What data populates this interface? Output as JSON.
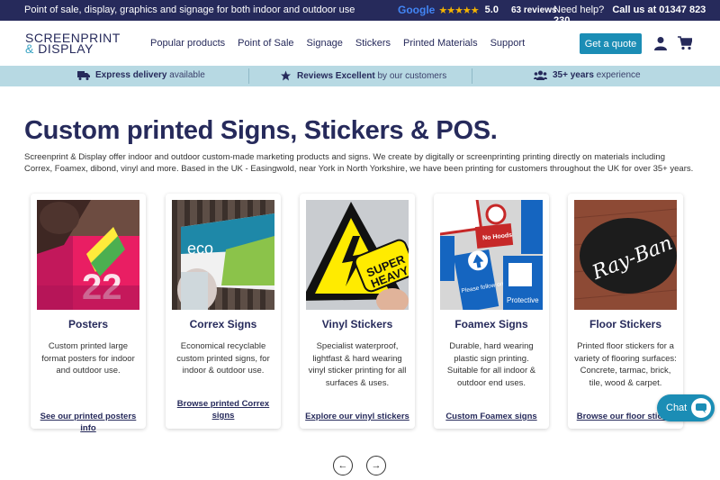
{
  "topbar": {
    "tagline": "Point of sale, display, graphics and signage for both indoor and outdoor use",
    "rating_brand": "Google",
    "rating_stars": "★★★★★",
    "rating_score": "5.0",
    "rating_reviews": "63 reviews",
    "help_text": "Need help?",
    "phone": "Call us at 01347 823 230"
  },
  "logo": {
    "line1": "SCREENPRINT",
    "line2_amp": "&",
    "line2": "DISPLAY"
  },
  "nav": {
    "links": [
      "Popular products",
      "Point of Sale",
      "Signage",
      "Stickers",
      "Printed Materials",
      "Support"
    ],
    "quote_button": "Get a quote"
  },
  "usp": [
    {
      "bold": "Express delivery",
      "rest": "available",
      "icon": "truck-icon"
    },
    {
      "bold": "Reviews Excellent",
      "rest": "by our customers",
      "icon": "star-icon"
    },
    {
      "bold": "35+ years",
      "rest": "experience",
      "icon": "people-icon"
    }
  ],
  "hero": {
    "title": "Custom printed Signs, Stickers & POS.",
    "text": "Screenprint & Display offer indoor and outdoor custom-made marketing products and signs. We create by digitally or screenprinting printing directly on materials including Correx, Foamex, dibond, vinyl and more. Based in the UK - Easingwold, near York in North Yorkshire, we have been printing for customers throughout the UK for over 35+ years."
  },
  "cards": [
    {
      "title": "Posters",
      "desc": "Custom printed large format posters for indoor and outdoor use.",
      "link": "See our printed posters info"
    },
    {
      "title": "Correx Signs",
      "desc": "Economical recyclable custom printed signs, for indoor & outdoor use.",
      "link": "Browse printed Correx signs"
    },
    {
      "title": "Vinyl Stickers",
      "desc": "Specialist waterproof, lightfast & hard wearing vinyl sticker printing for all surfaces & uses.",
      "link": "Explore our vinyl stickers"
    },
    {
      "title": "Foamex Signs",
      "desc": "Durable, hard wearing plastic sign printing. Suitable for all indoor & outdoor end uses.",
      "link": "Custom Foamex signs"
    },
    {
      "title": "Floor Stickers",
      "desc": "Printed floor stickers for a variety of flooring surfaces: Concrete, tarmac, brick, tile, wood & carpet.",
      "link": "Browse our floor stickers"
    }
  ],
  "card_images": {
    "correx_text": "eco",
    "vinyl_text1": "SUPER",
    "vinyl_text2": "HEAVY",
    "foamex_text1": "No Hoods",
    "foamex_text2": "Please follow one way system",
    "foamex_text3": "Protective",
    "floor_text": "Ray-Ban",
    "posters_text": "22"
  },
  "chat": {
    "label": "Chat"
  },
  "pager": {
    "prev": "←",
    "next": "→"
  }
}
